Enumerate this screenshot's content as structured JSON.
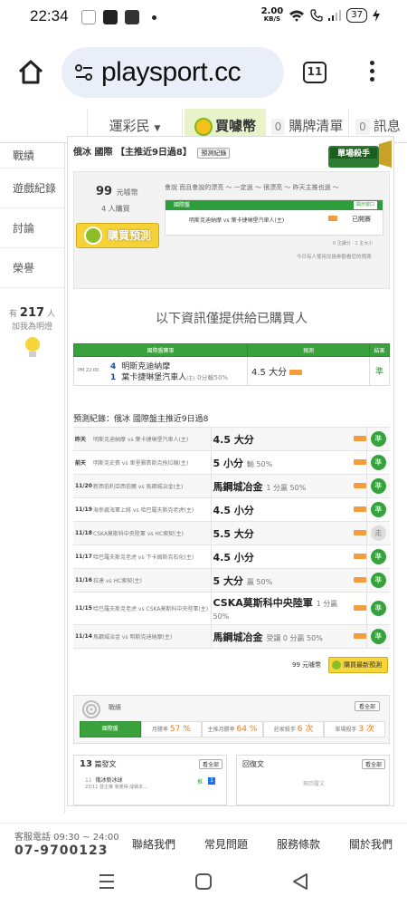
{
  "status": {
    "time": "22:34",
    "speed_value": "2.00",
    "speed_unit": "KB/S",
    "battery": "37"
  },
  "browser": {
    "url": "playsport.cc",
    "tab_count": "11"
  },
  "nav": {
    "item1": "運彩民",
    "item2": "買噱幣",
    "item3_count": "0",
    "item3": "購牌清單",
    "item4_count": "0",
    "item4": "訊息"
  },
  "sidebar": {
    "items": [
      "戰績",
      "遊戲紀錄",
      "討論",
      "榮譽"
    ],
    "like_prefix": "有",
    "like_count": "217",
    "like_suffix": "人",
    "like_caption": "加我為明燈"
  },
  "main": {
    "title": "俄冰 國際 【主推近9日過8】",
    "title_btn": "預測紀錄",
    "badge_text": "單場殺手",
    "price_value": "99",
    "price_unit": "元噱幣",
    "buyers": "4 人購買",
    "buy_btn": "購買預測",
    "intro": "會說 而且會說的漂亮 ～ 一定過 ～ 很漂亮 ～ 昨天主推也過 ～",
    "mini_header": "國際盤",
    "mini_open": "開示窗口",
    "mini_game": "明斯克迪納摩 vs 葉卡捷琳堡汽車人(主)",
    "mini_status": "已開賽",
    "mini_stats": "0 注讀分 · 1 主大小",
    "today_note": "今日有人使用兌換券觀看您的預測",
    "locked_msg": "以下資訊僅提供給已購買人"
  },
  "pred_table": {
    "headers": [
      "國際盤賽事",
      "預測",
      "結果"
    ],
    "time": "PM 22:00",
    "away_num": "4",
    "away": "明斯克迪納摩",
    "home_num": "1",
    "home": "葉卡捷琳堡汽車人",
    "home_mark": "(主)",
    "spread": "0分輸50%",
    "pick": "4.5 大分",
    "result": "準"
  },
  "history": {
    "title": "預測紀錄：俄冰 國際盤主推近9日過8",
    "rows": [
      {
        "date": "昨天",
        "game": "明斯克迪納摩 vs 葉卡捷琳堡汽車人(主)",
        "pick": "4.5 大分",
        "note": "",
        "res": "準"
      },
      {
        "date": "前天",
        "game": "明斯克史賓 vs 車里雅賓斯克拖拉機(主)",
        "pick": "5 小分",
        "note": "輸 50%",
        "res": "準"
      },
      {
        "date": "11/20",
        "game": "新西伯利亞西伯爾 vs 馬鋼城冶金(主)",
        "pick": "馬鋼城冶金",
        "note": "1 分贏 50%",
        "res": "準"
      },
      {
        "date": "11/19",
        "game": "海參崴海軍上將 vs 哈巴羅夫斯克老虎(主)",
        "pick": "4.5 小分",
        "note": "",
        "res": "準"
      },
      {
        "date": "11/18",
        "game": "CSKA莫斯科中央陸軍 vs HC索契(主)",
        "pick": "5.5 大分",
        "note": "",
        "res": "走"
      },
      {
        "date": "11/17",
        "game": "哈巴羅夫斯克老虎 vs 下卡姆斯克石化(主)",
        "pick": "4.5 小分",
        "note": "",
        "res": "準"
      },
      {
        "date": "11/16",
        "game": "拉達 vs HC索契(主)",
        "pick": "5 大分",
        "note": "贏 50%",
        "res": "準"
      },
      {
        "date": "11/15",
        "game": "哈巴羅夫斯克老虎 vs CSKA莫斯科中央陸軍(主)",
        "pick": "CSKA莫斯科中央陸軍",
        "note": "1 分贏 50%",
        "res": "準"
      },
      {
        "date": "11/14",
        "game": "馬鋼城冶金 vs 明斯克迪納摩(主)",
        "pick": "馬鋼城冶金",
        "note": "受讓 0 分贏 50%",
        "res": "準"
      }
    ]
  },
  "buy_again": {
    "price": "99 元噱幣",
    "btn": "購買最新預測"
  },
  "record": {
    "label": "戰績",
    "see_all": "看全部",
    "stats": [
      {
        "label": "國際盤",
        "value": ""
      },
      {
        "label": "月勝率 ",
        "value": "57 %"
      },
      {
        "label": "主推月勝率 ",
        "value": "64 %"
      },
      {
        "label": "莊家殺手 ",
        "value": "6 次"
      },
      {
        "label": "單場殺手 ",
        "value": "3 次"
      }
    ]
  },
  "articles": {
    "count": "13",
    "label": "篇發文",
    "see_all": "看全部",
    "entry_num": "11",
    "entry_title": "俄冰新冰球",
    "entry_meta": "23/11 發主推 我覺得 成績本...",
    "entry_tag": "推",
    "entry_count": "1"
  },
  "replies": {
    "label": "回復文",
    "see_all": "看全部",
    "none": "無回覆文"
  },
  "footer": {
    "service": "客服電話 09:30 ~ 24:00",
    "phone": "07-9700123",
    "links": [
      "聯絡我們",
      "常見問題",
      "服務條款",
      "關於我們"
    ]
  },
  "colors": {
    "green": "#3aa23c",
    "yellow": "#f4d238",
    "orange": "#f49d3c"
  }
}
